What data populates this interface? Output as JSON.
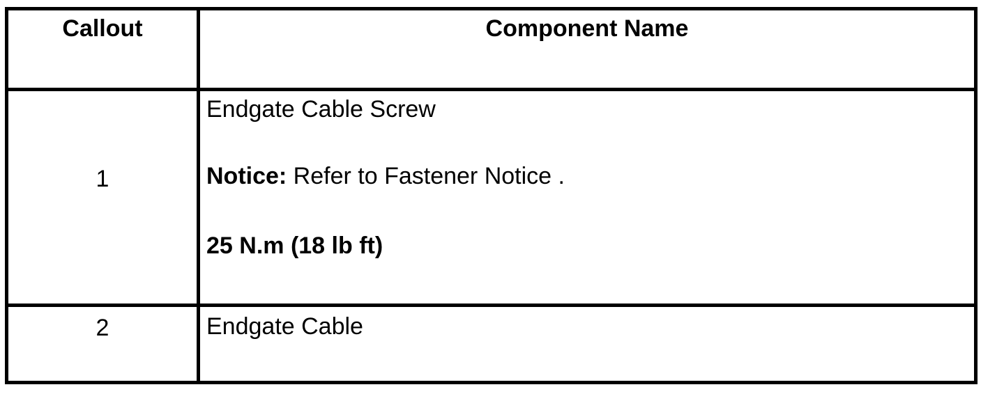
{
  "table": {
    "headers": {
      "callout": "Callout",
      "component": "Component Name"
    },
    "rows": [
      {
        "callout": "1",
        "name": "Endgate Cable Screw",
        "notice_label": "Notice:",
        "notice_text": " Refer to Fastener Notice .",
        "torque": "25 N.m (18 lb ft)"
      },
      {
        "callout": "2",
        "name": "Endgate Cable"
      }
    ]
  }
}
